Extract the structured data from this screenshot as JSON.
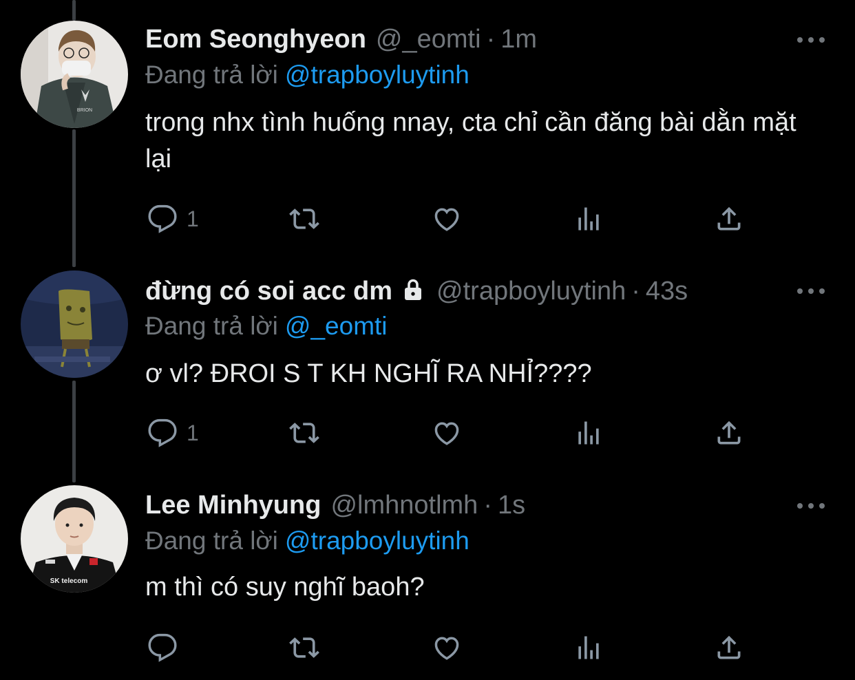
{
  "tweets": [
    {
      "display_name": "Eom Seonghyeon",
      "handle": "@_eomti",
      "separator": "·",
      "time": "1m",
      "replying_label": "Đang trả lời",
      "replying_to": "@trapboyluytinh",
      "text": "trong nhx tình huống nnay, cta chỉ cần đăng bài dằn mặt lại",
      "reply_count": "1",
      "retweet_count": "",
      "like_count": "",
      "protected": false,
      "avatar_caption": "BRION"
    },
    {
      "display_name": "đừng có soi acc dm",
      "handle": "@trapboyluytinh",
      "separator": "·",
      "time": "43s",
      "replying_label": "Đang trả lời",
      "replying_to": "@_eomti",
      "text": "ơ vl? ĐROI S T KH NGHĨ RA NHỈ????",
      "reply_count": "1",
      "retweet_count": "",
      "like_count": "",
      "protected": true
    },
    {
      "display_name": "Lee Minhyung",
      "handle": "@lmhnotlmh",
      "separator": "·",
      "time": "1s",
      "replying_label": "Đang trả lời",
      "replying_to": "@trapboyluytinh",
      "text": "m thì có suy nghĩ baoh?",
      "reply_count": "",
      "retweet_count": "",
      "like_count": "",
      "protected": false,
      "avatar_caption": "SK telecom"
    }
  ],
  "icons": {
    "reply": "reply-icon",
    "retweet": "retweet-icon",
    "like": "like-icon",
    "views": "views-icon",
    "share": "share-icon",
    "more": "more-icon",
    "lock": "lock-icon"
  },
  "colors": {
    "background": "#000000",
    "text": "#e7e9ea",
    "secondary": "#71767b",
    "link": "#1d9bf0",
    "thread_line": "#3c4044"
  }
}
